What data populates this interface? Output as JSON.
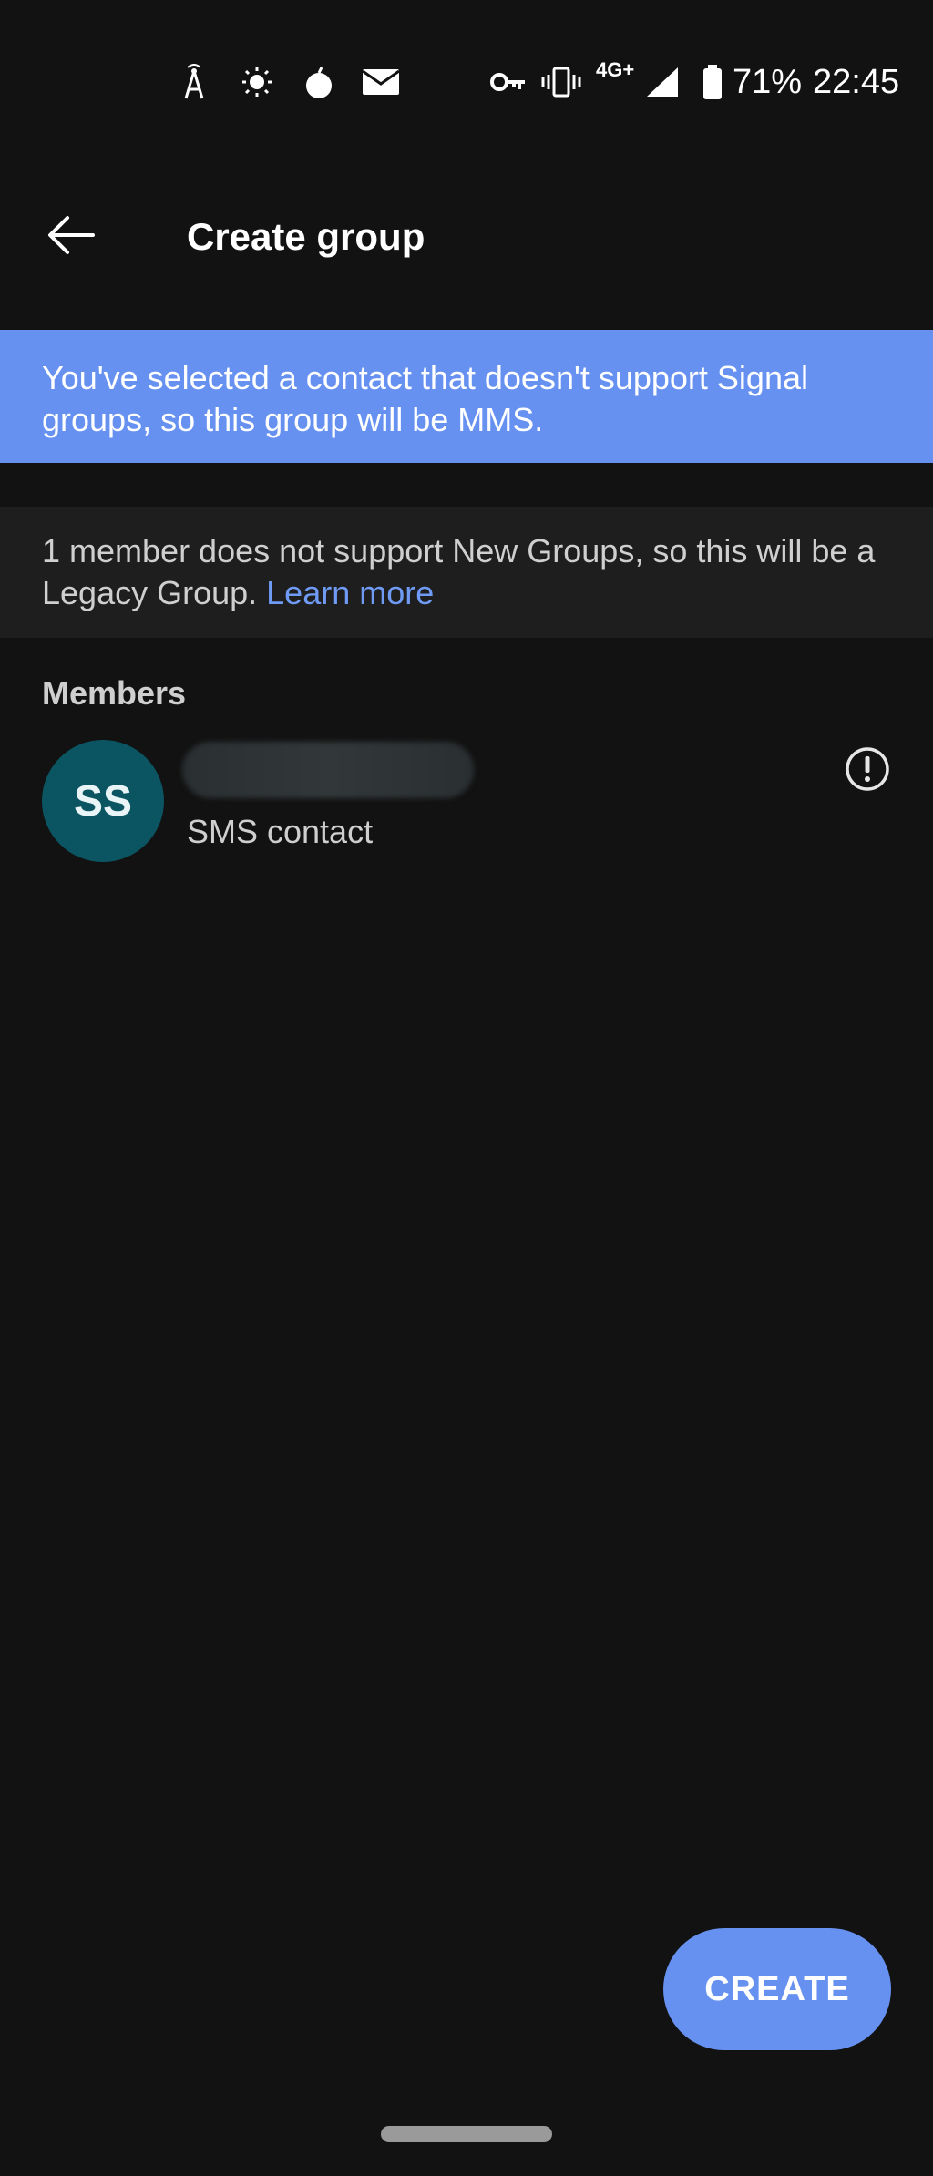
{
  "status_bar": {
    "network_type": "4G+",
    "battery": "71%",
    "time": "22:45",
    "icons": [
      "antenna-icon",
      "sun-icon",
      "bomb-icon",
      "mail-icon",
      "vpn-key-icon",
      "vibrate-icon",
      "signal-icon",
      "battery-icon"
    ]
  },
  "app_bar": {
    "back_icon": "arrow-left-icon",
    "title": "Create group"
  },
  "mms_banner": {
    "text": "You've selected a contact that doesn't support Signal groups, so this group will be MMS.",
    "color": "#6691f0"
  },
  "legacy_notice": {
    "text": "1 member does not support New Groups, so this will be a Legacy Group. ",
    "link_text": "Learn more",
    "link_color": "#6f9bf5"
  },
  "members": {
    "header": "Members",
    "items": [
      {
        "initials": "SS",
        "name": "",
        "subtitle": "SMS contact",
        "avatar_color": "#0b5563",
        "action_icon": "alert-circle-icon"
      }
    ]
  },
  "actions": {
    "create_label": "CREATE"
  }
}
